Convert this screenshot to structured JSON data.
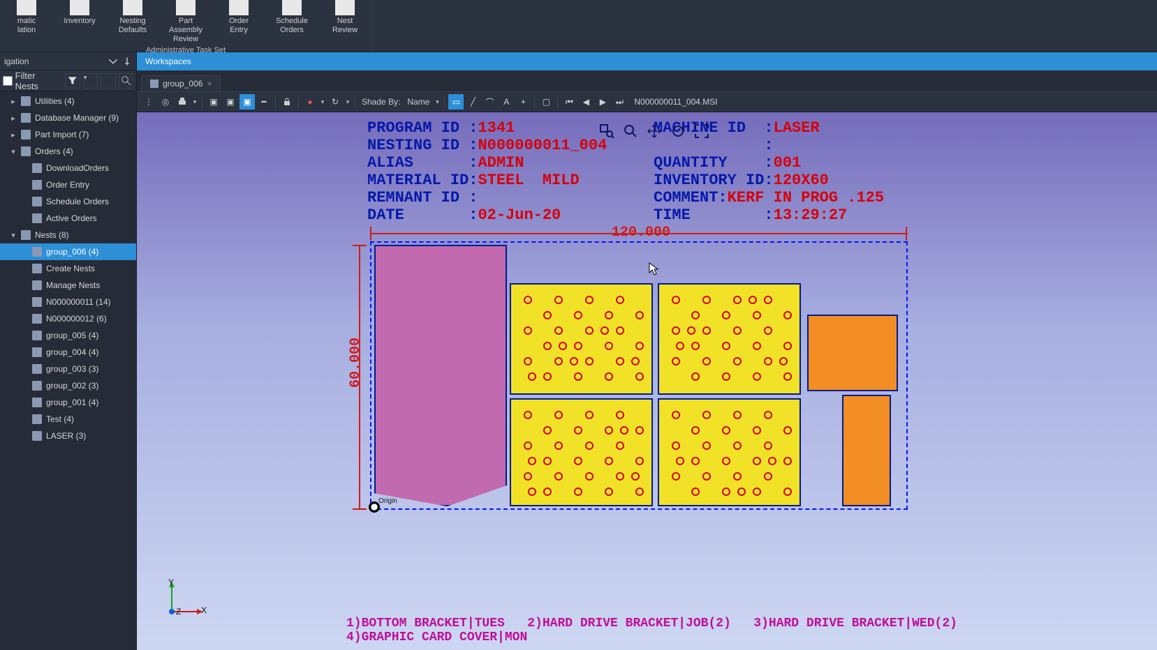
{
  "ribbon": {
    "group_title": "Administrative Task Set",
    "buttons": [
      {
        "line1": "matic",
        "line2": "lation"
      },
      {
        "line1": "Inventory",
        "line2": ""
      },
      {
        "line1": "Nesting",
        "line2": "Defaults"
      },
      {
        "line1": "Part",
        "line2": "Assembly Review"
      },
      {
        "line1": "Order",
        "line2": "Entry"
      },
      {
        "line1": "Schedule",
        "line2": "Orders"
      },
      {
        "line1": "Nest",
        "line2": "Review"
      }
    ]
  },
  "sidebar": {
    "title": "igation",
    "filter_label": "Filter Nests",
    "tree": [
      {
        "label": "Utilities (4)",
        "level": 1,
        "exp": "▸"
      },
      {
        "label": "Database Manager (9)",
        "level": 1,
        "exp": "▸"
      },
      {
        "label": "Part Import (7)",
        "level": 1,
        "exp": "▸"
      },
      {
        "label": "Orders (4)",
        "level": 1,
        "exp": "▾"
      },
      {
        "label": "DownloadOrders",
        "level": 2
      },
      {
        "label": "Order Entry",
        "level": 2
      },
      {
        "label": "Schedule Orders",
        "level": 2
      },
      {
        "label": "Active Orders",
        "level": 2
      },
      {
        "label": "Nests (8)",
        "level": 1,
        "exp": "▾"
      },
      {
        "label": "group_006 (4)",
        "level": 2,
        "selected": true
      },
      {
        "label": "Create Nests",
        "level": 2
      },
      {
        "label": "Manage Nests",
        "level": 2
      },
      {
        "label": "N000000011 (14)",
        "level": 2,
        "exp": "▸"
      },
      {
        "label": "N000000012 (6)",
        "level": 2,
        "exp": "▸"
      },
      {
        "label": "group_005 (4)",
        "level": 2
      },
      {
        "label": "group_004 (4)",
        "level": 2
      },
      {
        "label": "group_003 (3)",
        "level": 2
      },
      {
        "label": "group_002 (3)",
        "level": 2
      },
      {
        "label": "group_001 (4)",
        "level": 2
      },
      {
        "label": "Test (4)",
        "level": 2
      },
      {
        "label": "LASER (3)",
        "level": 2
      }
    ]
  },
  "workspaces_label": "Workspaces",
  "doc_tab": "group_006",
  "toolbar": {
    "shade_label": "Shade By:",
    "shade_value": "Name",
    "file": "N000000011_004.MSI"
  },
  "info": {
    "left": {
      "PROGRAM ID ": "1341",
      "NESTING ID ": "N000000011_004",
      "ALIAS      ": "ADMIN",
      "MATERIAL ID": "STEEL  MILD",
      "REMNANT ID ": "",
      "DATE       ": "02-Jun-20"
    },
    "right": {
      "MACHINE ID  ": "LASER",
      "            ": "",
      "QUANTITY    ": "001",
      "INVENTORY ID": "120X60",
      "COMMENT": "KERF IN PROG .125",
      "TIME        ": "13:29:27"
    }
  },
  "dims": {
    "width": "120.000",
    "height": "60.000"
  },
  "footer": {
    "line1": "1)BOTTOM BRACKET|TUES   2)HARD DRIVE BRACKET|JOB(2)   3)HARD DRIVE BRACKET|WED(2)",
    "line2": "4)GRAPHIC CARD COVER|MON"
  },
  "origin_label": "Origin",
  "axis": {
    "x": "X",
    "y": "Y",
    "z": "Z"
  }
}
